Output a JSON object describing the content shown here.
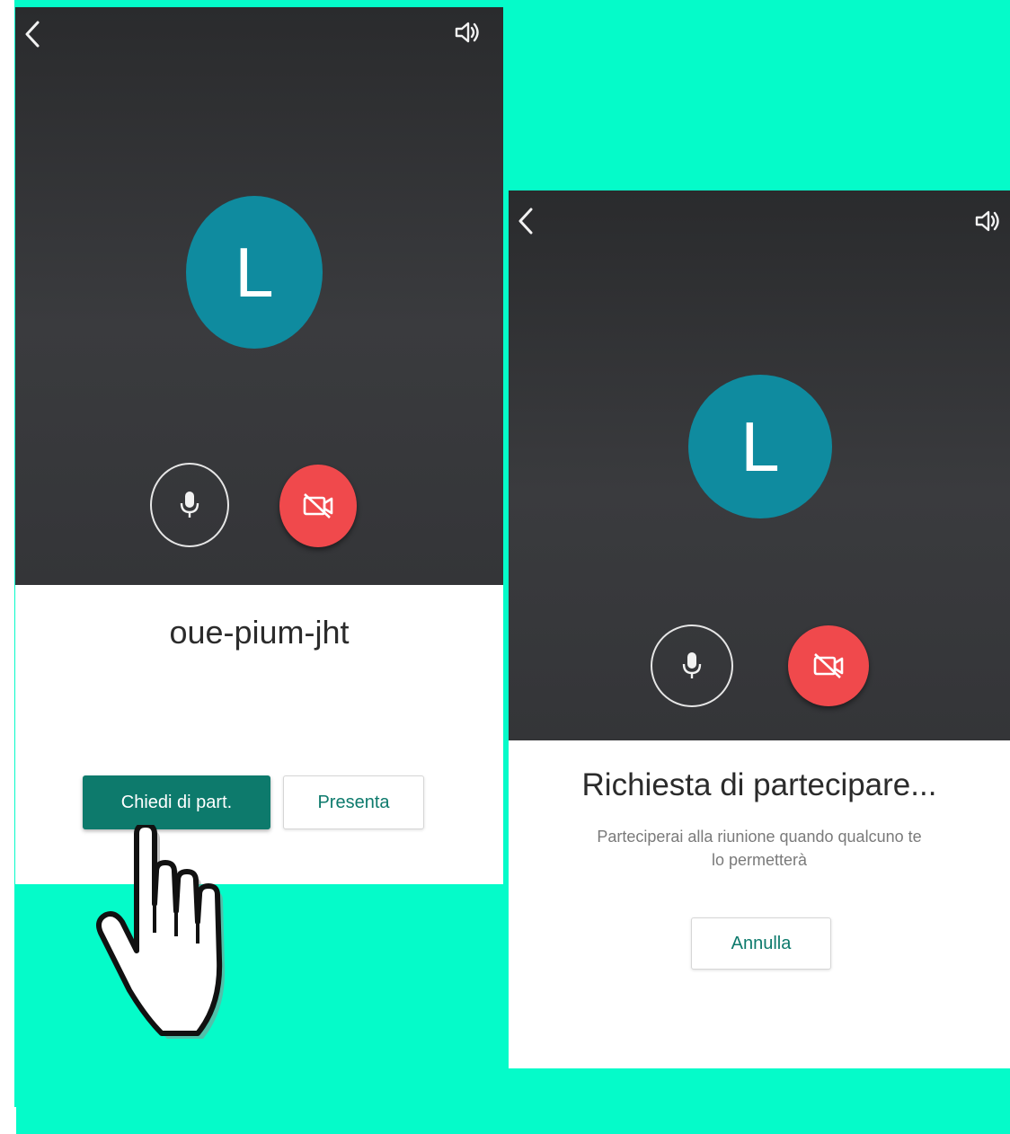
{
  "colors": {
    "backdrop": "#05fbc9",
    "dark_panel": "#343538",
    "avatar": "#0f8b9f",
    "camera_off": "#f0494c",
    "primary_button": "#0d7a6c"
  },
  "left_screen": {
    "back_icon": "chevron-left-icon",
    "speaker_icon": "speaker-icon",
    "avatar_initial": "L",
    "mic_icon": "microphone-icon",
    "camera_icon": "camera-off-icon",
    "meeting_code": "oue-pium-jht",
    "ask_to_join_label": "Chiedi di part.",
    "present_label": "Presenta",
    "pointer_icon": "hand-pointer-icon"
  },
  "right_screen": {
    "back_icon": "chevron-left-icon",
    "speaker_icon": "speaker-icon",
    "avatar_initial": "L",
    "mic_icon": "microphone-icon",
    "camera_icon": "camera-off-icon",
    "status_title": "Richiesta di partecipare...",
    "status_subtitle_line1": "Parteciperai alla riunione quando qualcuno te",
    "status_subtitle_line2": "lo permetterà",
    "cancel_label": "Annulla"
  }
}
